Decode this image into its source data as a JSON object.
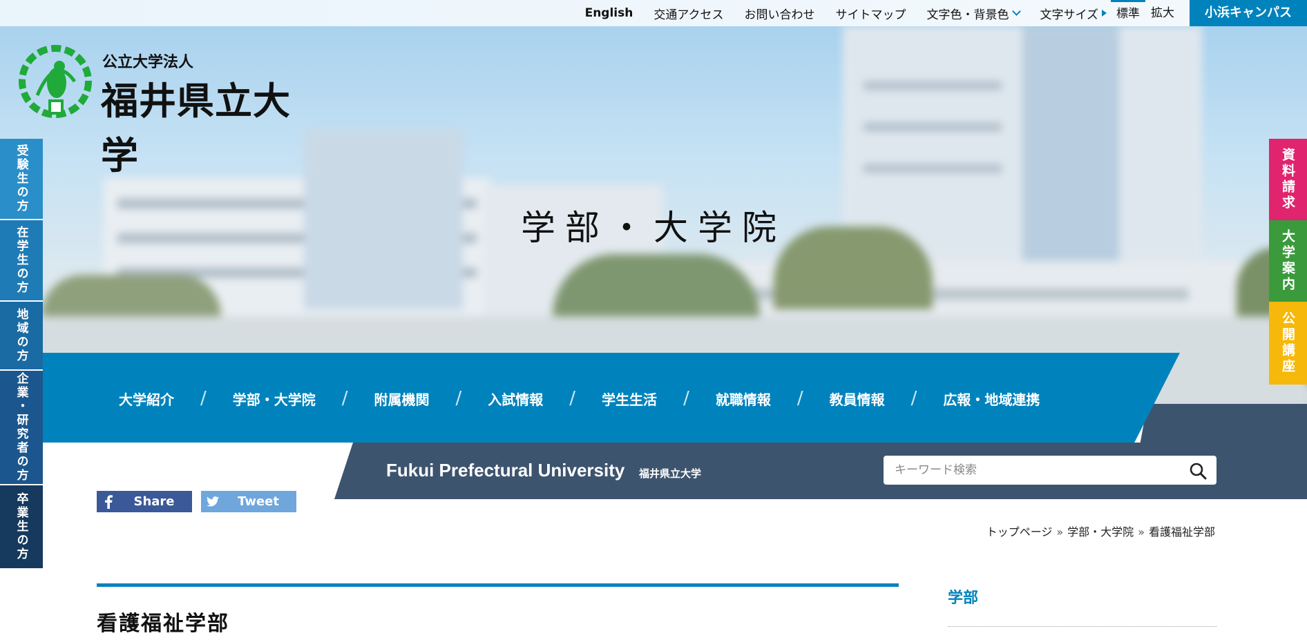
{
  "topbar": {
    "links": [
      "English",
      "交通アクセス",
      "お問い合わせ",
      "サイトマップ"
    ],
    "color_label": "文字色・背景色",
    "size_label": "文字サイズ",
    "size_standard": "標準",
    "size_large": "拡大",
    "campus_button": "小浜キャンパス"
  },
  "logo": {
    "sub": "公立大学法人",
    "main": "福井県立大学"
  },
  "hero": {
    "title": "学部・大学院"
  },
  "left_tabs": [
    {
      "label": "受験生の方",
      "color": "#2a8ec9"
    },
    {
      "label": "在学生の方",
      "color": "#1f7bb6"
    },
    {
      "label": "地域の方",
      "color": "#1a6aa3"
    },
    {
      "label": "企業・研究者の方",
      "color": "#1b578e"
    },
    {
      "label": "卒業生の方",
      "color": "#16395e"
    }
  ],
  "right_tabs": [
    {
      "label": "資料請求",
      "color": "#e0246e"
    },
    {
      "label": "大学案内",
      "color": "#3a9a3c"
    },
    {
      "label": "公開講座",
      "color": "#f6b80a"
    }
  ],
  "main_nav": [
    "大学紹介",
    "学部・大学院",
    "附属機関",
    "入試情報",
    "学生生活",
    "就職情報",
    "教員情報",
    "広報・地域連携"
  ],
  "band": {
    "name_en": "Fukui Prefectural University",
    "name_jp": "福井県立大学",
    "search_placeholder": "キーワード検索"
  },
  "share": {
    "facebook": "Share",
    "twitter": "Tweet"
  },
  "breadcrumb": [
    "トップページ",
    "学部・大学院",
    "看護福祉学部"
  ],
  "content": {
    "title": "看護福祉学部"
  },
  "sidebar": {
    "heading": "学部"
  },
  "colors": {
    "accent": "#0083bd",
    "band": "#3d546e",
    "facebook": "#3b5998",
    "twitter": "#6fa6dc"
  }
}
